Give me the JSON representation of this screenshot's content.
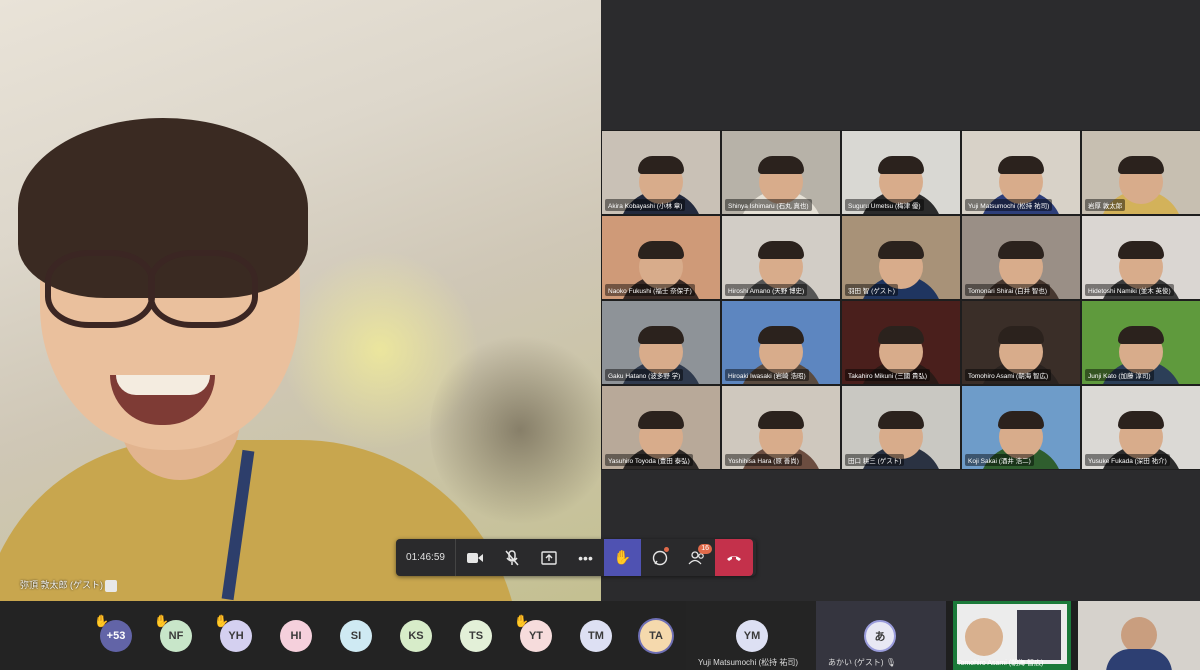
{
  "speaker": {
    "name": "弥頂 敦太郎 (ゲスト)"
  },
  "grid": [
    {
      "name": "Akira Kobayashi (小林 章)",
      "bg": "#c9c1b6",
      "shirt": "#232a3d"
    },
    {
      "name": "Shinya Ishimaru (石丸 真也)",
      "bg": "#b7b2a8",
      "shirt": "#e6e1d6"
    },
    {
      "name": "Suguru Umetsu (梅津 優)",
      "bg": "#d9d8d3",
      "shirt": "#2b2b2b"
    },
    {
      "name": "Yuji Matsumochi (松持 祐司)",
      "bg": "#d8d2c8",
      "shirt": "#2e3f7a"
    },
    {
      "name": "岩厚 敦太郎",
      "bg": "#c7bfb1",
      "shirt": "#d3b25a"
    },
    {
      "name": "Naoko Fukushi (福士 奈保子)",
      "bg": "#cf9a78",
      "shirt": "#3a2b26"
    },
    {
      "name": "Hiroshi Amano (天野 博史)",
      "bg": "#d2cdc6",
      "shirt": "#555555"
    },
    {
      "name": "羽田 智 (ゲスト)",
      "bg": "#a89278",
      "shirt": "#1f3560"
    },
    {
      "name": "Tomonari Shirai (白井 智也)",
      "bg": "#9a8f86",
      "shirt": "#473830"
    },
    {
      "name": "Hidetoshi Namiki (並木 英俊)",
      "bg": "#dad6d2",
      "shirt": "#3c3c3c"
    },
    {
      "name": "Gaku Hatano (波多野 学)",
      "bg": "#8e9398",
      "shirt": "#2f3a4d"
    },
    {
      "name": "Hiroaki Iwasaki (岩崎 浩昭)",
      "bg": "#5d86c0",
      "shirt": "#5a4b40"
    },
    {
      "name": "Takahiro Mikuni (三國 貴弘)",
      "bg": "#4a1f1c",
      "shirt": "#2a1a16"
    },
    {
      "name": "Tomohiro Asami (朝海 智広)",
      "bg": "#3a2e28",
      "shirt": "#2a2320"
    },
    {
      "name": "Junji Kato (加藤 淳司)",
      "bg": "#5f9a3d",
      "shirt": "#2c3f58"
    },
    {
      "name": "Yasuhiro Toyoda (豊田 泰弘)",
      "bg": "#b8a999",
      "shirt": "#2e2a28"
    },
    {
      "name": "Yoshihisa Hara (原 善尚)",
      "bg": "#cfc8be",
      "shirt": "#6b4d40"
    },
    {
      "name": "田口 耕三 (ゲスト)",
      "bg": "#c9c8c2",
      "shirt": "#2a3242"
    },
    {
      "name": "Koji Sakai (酒井 浩二)",
      "bg": "#6e9cc9",
      "shirt": "#2f5e2e"
    },
    {
      "name": "Yusuke Fukada (深田 祐介)",
      "bg": "#dbd9d5",
      "shirt": "#2c2c2c"
    }
  ],
  "controls": {
    "timer": "01:46:59",
    "participants_badge": "16"
  },
  "strip": {
    "avatars": [
      {
        "initials": "+53",
        "bg": "#6264a7",
        "color": "#ffffff",
        "hand": true
      },
      {
        "initials": "NF",
        "bg": "#c8e6c9",
        "color": "#3a3a3a",
        "hand": true
      },
      {
        "initials": "YH",
        "bg": "#d4d0f0",
        "color": "#3a3a3a",
        "hand": true
      },
      {
        "initials": "HI",
        "bg": "#f5d0dc",
        "color": "#3a3a3a",
        "hand": false
      },
      {
        "initials": "SI",
        "bg": "#cfeaf3",
        "color": "#3a3a3a",
        "hand": false
      },
      {
        "initials": "KS",
        "bg": "#d7ecc9",
        "color": "#3a3a3a",
        "hand": false
      },
      {
        "initials": "TS",
        "bg": "#e3f0d8",
        "color": "#3a3a3a",
        "hand": false
      },
      {
        "initials": "YT",
        "bg": "#f6dcdc",
        "color": "#3a3a3a",
        "hand": true
      },
      {
        "initials": "TM",
        "bg": "#dde0f3",
        "color": "#3a3a3a",
        "hand": false
      },
      {
        "initials": "TA",
        "bg": "#f5d9ad",
        "color": "#3a3a3a",
        "hand": false
      }
    ],
    "ym": {
      "initials": "YM",
      "name": "Yuji Matsumochi (松持 祐司)"
    },
    "akai": {
      "initials": "あ",
      "name": "あかい (ゲスト)"
    },
    "share_name": "Tomohiro Asami (朝海 智広)"
  }
}
